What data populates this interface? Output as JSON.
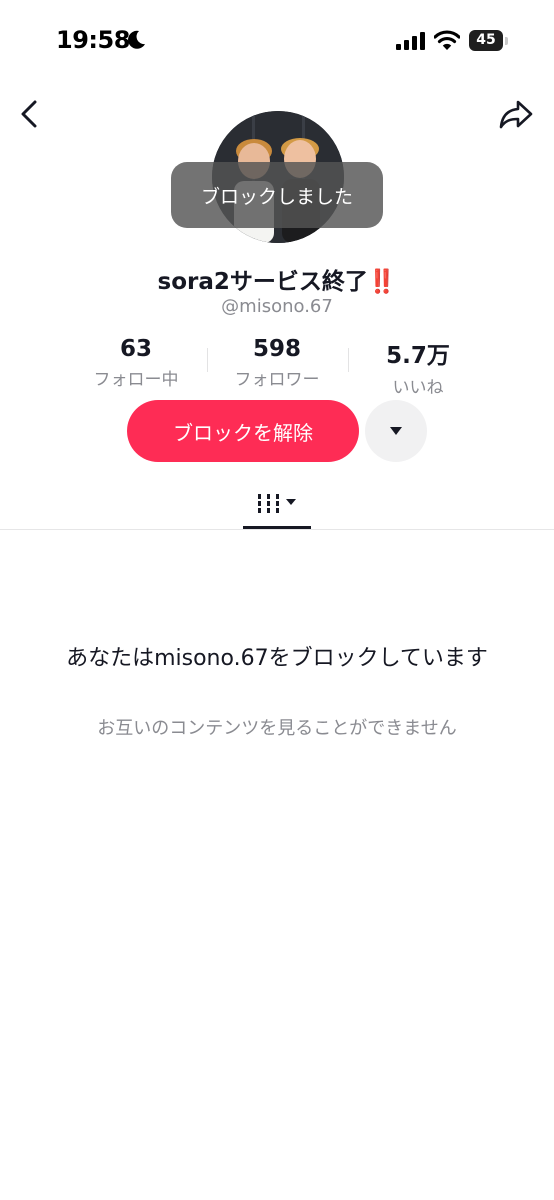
{
  "status_bar": {
    "time": "19:58",
    "battery": "45",
    "icons": [
      "moon-icon",
      "signal-icon",
      "wifi-icon",
      "battery-icon"
    ]
  },
  "nav": {
    "icons": [
      "back-chevron-icon",
      "share-arrow-icon"
    ]
  },
  "toast": {
    "text": "ブロックしました"
  },
  "profile": {
    "display_name": "sora2サービス終了",
    "name_mark": "‼️",
    "username": "@misono.67"
  },
  "stats": [
    {
      "value": "63",
      "label": "フォロー中"
    },
    {
      "value": "598",
      "label": "フォロワー"
    },
    {
      "value": "5.7万",
      "label": "いいね"
    }
  ],
  "actions": {
    "unblock_label": "ブロックを解除",
    "more_icon": "caret-down-icon"
  },
  "tabs": {
    "active_icon": "grid-videos-icon"
  },
  "empty_state": {
    "title": "あなたはmisono.67をブロックしています",
    "subtitle": "お互いのコンテンツを見ることができません"
  },
  "colors": {
    "accent": "#fe2c55",
    "text_primary": "#161823",
    "text_secondary": "#8a8b91",
    "toast_bg": "#545454"
  }
}
